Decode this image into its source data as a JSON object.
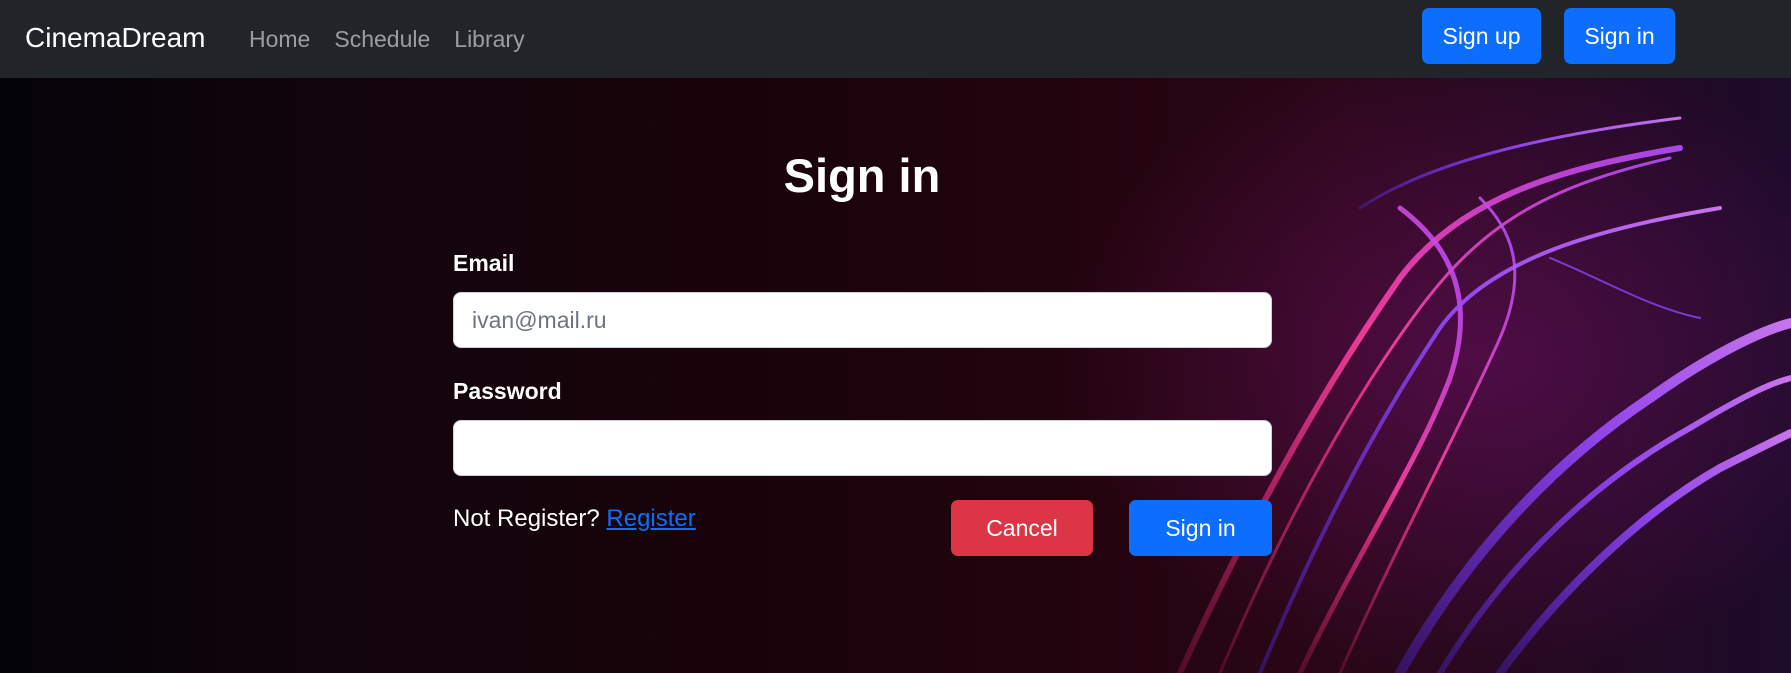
{
  "navbar": {
    "brand": "CinemaDream",
    "links": [
      "Home",
      "Schedule",
      "Library"
    ],
    "signup_label": "Sign up",
    "signin_label": "Sign in",
    "background": "#212529"
  },
  "form": {
    "title": "Sign in",
    "email_label": "Email",
    "email_placeholder": "ivan@mail.ru",
    "email_value": "",
    "password_label": "Password",
    "password_value": "",
    "not_registered_text": "Not Register?",
    "register_link": "Register",
    "cancel_label": "Cancel",
    "submit_label": "Sign in"
  },
  "colors": {
    "primary": "#0d6efd",
    "danger": "#dc3545"
  }
}
